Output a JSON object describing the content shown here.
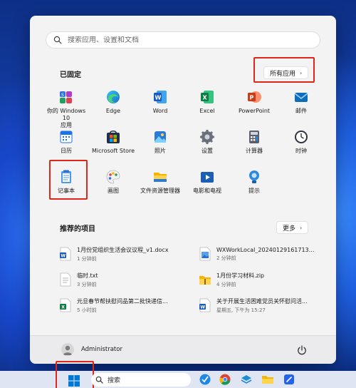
{
  "search": {
    "placeholder": "搜索应用、设置和文档"
  },
  "pinned": {
    "title": "已固定",
    "all_apps_label": "所有应用",
    "apps": [
      {
        "label": "你的 Windows 10\n应用",
        "icon": "windows-apps-icon"
      },
      {
        "label": "Edge",
        "icon": "edge-icon"
      },
      {
        "label": "Word",
        "icon": "word-icon"
      },
      {
        "label": "Excel",
        "icon": "excel-icon"
      },
      {
        "label": "PowerPoint",
        "icon": "powerpoint-icon"
      },
      {
        "label": "邮件",
        "icon": "mail-icon"
      },
      {
        "label": "日历",
        "icon": "calendar-icon"
      },
      {
        "label": "Microsoft Store",
        "icon": "store-icon"
      },
      {
        "label": "照片",
        "icon": "photos-icon"
      },
      {
        "label": "设置",
        "icon": "settings-icon"
      },
      {
        "label": "计算器",
        "icon": "calculator-icon"
      },
      {
        "label": "时钟",
        "icon": "clock-icon"
      },
      {
        "label": "记事本",
        "icon": "notepad-icon"
      },
      {
        "label": "画图",
        "icon": "paint-icon"
      },
      {
        "label": "文件资源管理器",
        "icon": "file-explorer-icon"
      },
      {
        "label": "电影和电视",
        "icon": "movies-tv-icon"
      },
      {
        "label": "提示",
        "icon": "tips-icon"
      }
    ]
  },
  "recommended": {
    "title": "推荐的项目",
    "more_label": "更多",
    "items": [
      {
        "name": "1月份党组织生活会议议程_v1.docx",
        "time": "1 分钟前",
        "icon": "word-doc-icon"
      },
      {
        "name": "WXWorkLocal_20240129161713.png",
        "time": "2 分钟前",
        "icon": "image-file-icon"
      },
      {
        "name": "临时.txt",
        "time": "3 分钟前",
        "icon": "text-file-icon"
      },
      {
        "name": "1月份学习材料.zip",
        "time": "4 分钟前",
        "icon": "zip-folder-icon"
      },
      {
        "name": "元旦春节帮扶慰问品第二批快递信...",
        "time": "5 小时前",
        "icon": "excel-doc-icon"
      },
      {
        "name": "关于开展生活困难党员关怀慰问活...",
        "time": "星期五, 下午为 15:27",
        "icon": "word-doc-icon"
      }
    ]
  },
  "footer": {
    "username": "Administrator"
  },
  "taskbar": {
    "search_label": "搜索"
  },
  "colors": {
    "highlight": "#e0251b",
    "accent": "#0067c0"
  }
}
